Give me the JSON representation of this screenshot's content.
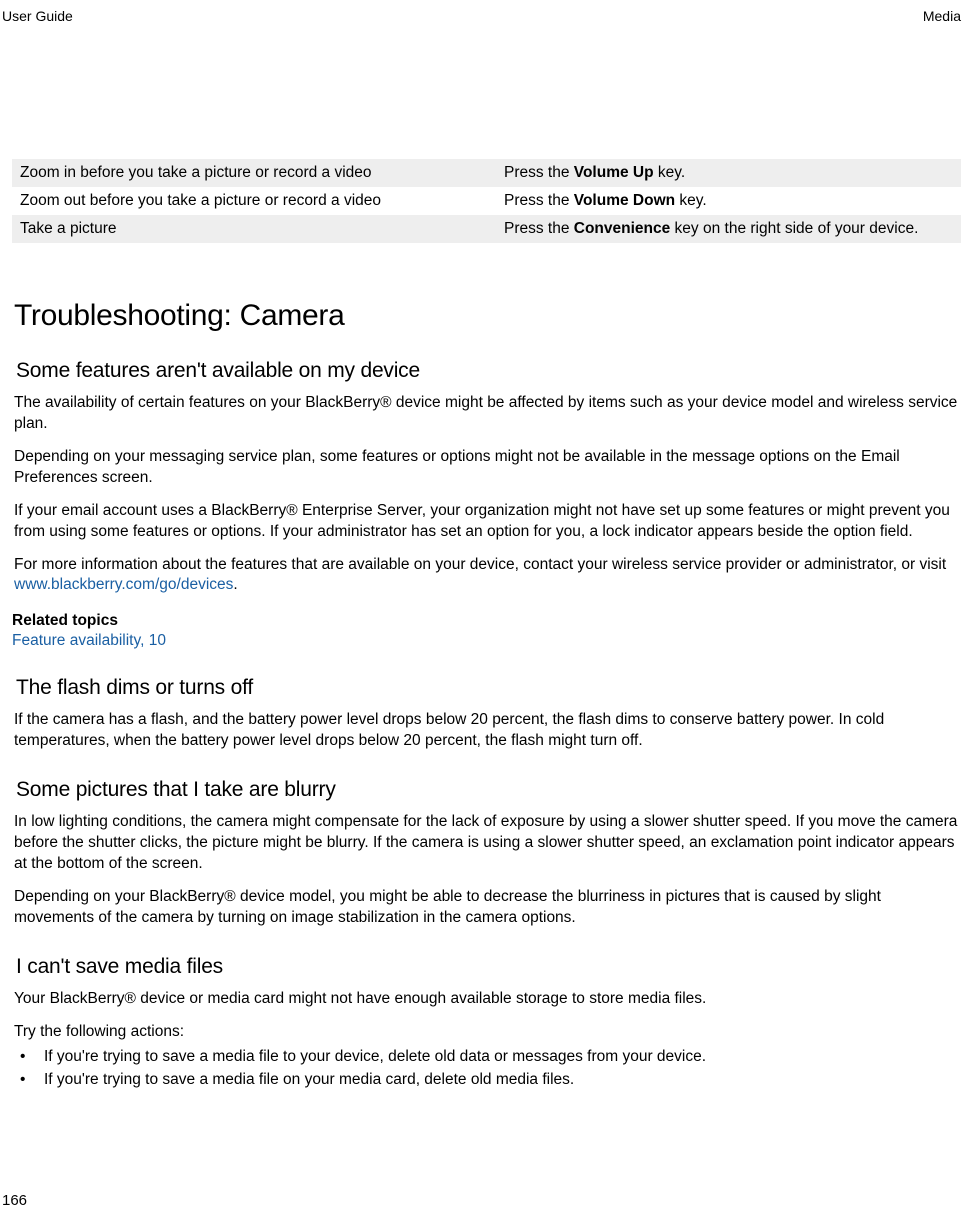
{
  "header": {
    "left": "User Guide",
    "right": "Media"
  },
  "table": {
    "rows": [
      {
        "left": "Zoom in before you take a picture or record a video",
        "right_pre": "Press the ",
        "right_bold": "Volume Up",
        "right_post": " key."
      },
      {
        "left": "Zoom out before you take a picture or record a video",
        "right_pre": "Press the ",
        "right_bold": "Volume Down",
        "right_post": " key."
      },
      {
        "left": "Take a picture",
        "right_pre": "Press the ",
        "right_bold": "Convenience",
        "right_post": " key on the right side of your device."
      }
    ]
  },
  "h1": "Troubleshooting: Camera",
  "sec1": {
    "title": "Some features aren't available on my device",
    "p1": "The availability of certain features on your BlackBerry® device might be affected by items such as your device model and wireless service plan.",
    "p2": "Depending on your messaging service plan, some features or options might not be available in the message options on the Email Preferences screen.",
    "p3": "If your email account uses a BlackBerry® Enterprise Server, your organization might not have set up some features or might prevent you from using some features or options. If your administrator has set an option for you, a lock indicator appears beside the option field.",
    "p4_pre": "For more information about the features that are available on your device, contact your wireless service provider or administrator, or visit ",
    "p4_link": "www.blackberry.com/go/devices",
    "p4_post": ".",
    "related_label": "Related topics",
    "related_link": "Feature availability, 10"
  },
  "sec2": {
    "title": "The flash dims or turns off",
    "p1": "If the camera has a flash, and the battery power level drops below 20 percent, the flash dims to conserve battery power. In cold temperatures, when the battery power level drops below 20 percent, the flash might turn off."
  },
  "sec3": {
    "title": "Some pictures that I take are blurry",
    "p1": "In low lighting conditions, the camera might compensate for the lack of exposure by using a slower shutter speed. If you move the camera before the shutter clicks, the picture might be blurry. If the camera is using a slower shutter speed, an exclamation point indicator appears at the bottom of the screen.",
    "p2": "Depending on your BlackBerry® device model, you might be able to decrease the blurriness in pictures that is caused by slight movements of the camera by turning on image stabilization in the camera options."
  },
  "sec4": {
    "title": "I can't save media files",
    "p1": "Your BlackBerry® device or media card might not have enough available storage to store media files.",
    "p2": "Try the following actions:",
    "bullets": [
      "If you're trying to save a media file to your device, delete old data or messages from your device.",
      "If you're trying to save a media file on your media card, delete old media files."
    ]
  },
  "page_number": "166"
}
